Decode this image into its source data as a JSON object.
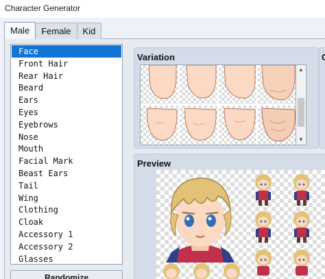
{
  "window": {
    "title": "Character Generator"
  },
  "tabs": [
    {
      "label": "Male",
      "active": true
    },
    {
      "label": "Female",
      "active": false
    },
    {
      "label": "Kid",
      "active": false
    }
  ],
  "parts": {
    "items": [
      "Face",
      "Front Hair",
      "Rear Hair",
      "Beard",
      "Ears",
      "Eyes",
      "Eyebrows",
      "Nose",
      "Mouth",
      "Facial Mark",
      "Beast Ears",
      "Tail",
      "Wing",
      "Clothing",
      "Cloak",
      "Accessory 1",
      "Accessory 2",
      "Glasses"
    ],
    "selected": "Face"
  },
  "buttons": {
    "randomize": "Randomize"
  },
  "variation": {
    "title": "Variation"
  },
  "preview": {
    "title": "Preview"
  },
  "colors": {
    "selection": "#1175d8",
    "hair": "#e2c277",
    "skin": "#fbd9c2",
    "eyes": "#2f6fb8",
    "armor": "#c0304a",
    "cape": "#2f3f88"
  }
}
